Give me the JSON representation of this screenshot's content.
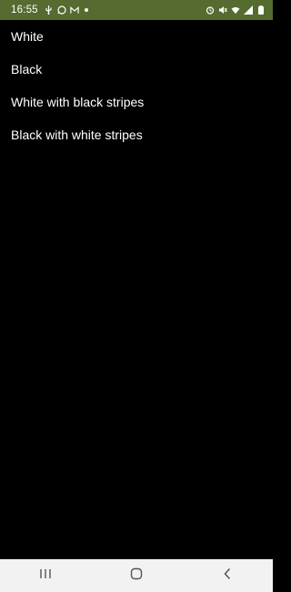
{
  "status_bar": {
    "time": "16:55",
    "bg_color": "#556b2f",
    "left_icons": [
      "usb-icon",
      "whatsapp-icon",
      "gmail-icon",
      "notification-dot-icon"
    ],
    "right_icons": [
      "alarm-icon",
      "mute-icon",
      "wifi-icon",
      "signal-icon",
      "battery-icon"
    ]
  },
  "list": {
    "items": [
      {
        "label": "White"
      },
      {
        "label": "Black"
      },
      {
        "label": "White with black stripes"
      },
      {
        "label": "Black with white stripes"
      }
    ]
  },
  "nav_bar": {
    "buttons": [
      "recent-apps-icon",
      "home-icon",
      "back-icon"
    ]
  }
}
